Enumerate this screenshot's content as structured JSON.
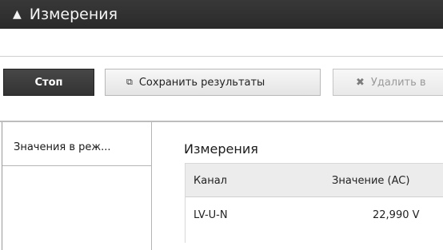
{
  "header": {
    "title": "Измерения"
  },
  "toolbar": {
    "stop_label": "Стоп",
    "save_label": "Сохранить результаты",
    "delete_label": "Удалить в"
  },
  "left_panel": {
    "item_label": "Значения в реж..."
  },
  "measurements": {
    "title": "Измерения",
    "columns": [
      "Канал",
      "Значение (AC)"
    ],
    "rows": [
      [
        "LV-U-N",
        "22,990 V"
      ]
    ]
  }
}
